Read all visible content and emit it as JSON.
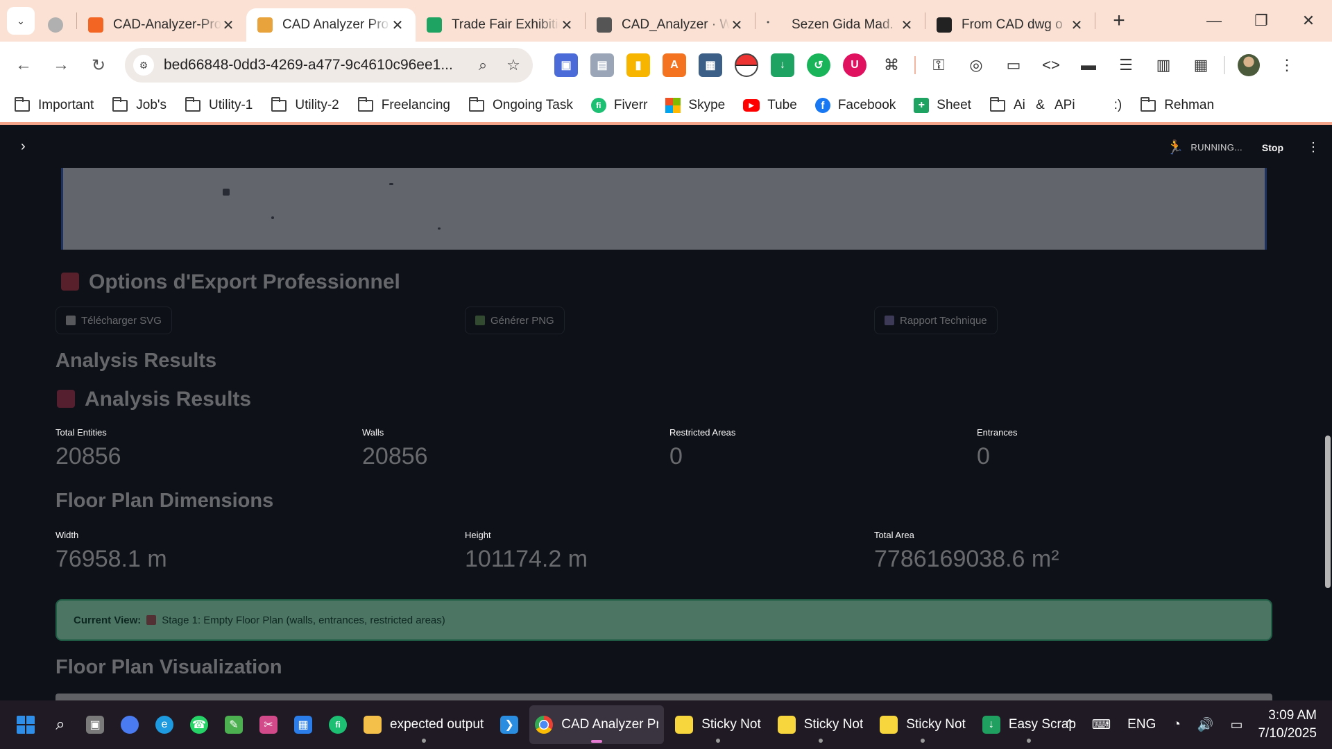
{
  "browser": {
    "tabs": [
      {
        "title": "",
        "favicon_color": "#b0b0b0"
      },
      {
        "title": "CAD-Analyzer-Pro",
        "favicon_color": "#f26522",
        "favicon": "replit-icon"
      },
      {
        "title": "CAD Analyzer Pro",
        "favicon_color": "#e8a33c",
        "favicon": "building-icon",
        "active": true
      },
      {
        "title": "Trade Fair Exhibition",
        "favicon_color": "#1ea362",
        "favicon": "sheets-icon"
      },
      {
        "title": "CAD_Analyzer · W",
        "favicon_color": "#555555",
        "favicon": "link-icon"
      },
      {
        "title": "Sezen Gida Mad.",
        "favicon_color": "#777777",
        "favicon": "dot-icon"
      },
      {
        "title": "From CAD dwg o",
        "favicon_color": "#222222",
        "favicon": "openai-icon"
      }
    ],
    "url": "bed66848-0dd3-4269-a477-9c4610c96ee1...",
    "bookmarks": [
      {
        "label": "Important",
        "icon": "folder-icon"
      },
      {
        "label": "Job's",
        "icon": "folder-icon"
      },
      {
        "label": "Utility-1",
        "icon": "folder-icon"
      },
      {
        "label": "Utility-2",
        "icon": "folder-icon"
      },
      {
        "label": "Freelancing",
        "icon": "folder-icon"
      },
      {
        "label": "Ongoing Task",
        "icon": "folder-icon"
      },
      {
        "label": "Fiverr",
        "icon": "fiverr-icon"
      },
      {
        "label": "Skype",
        "icon": "microsoft-icon"
      },
      {
        "label": "Tube",
        "icon": "youtube-icon"
      },
      {
        "label": "Facebook",
        "icon": "facebook-icon"
      },
      {
        "label": "Sheet",
        "icon": "sheets-icon"
      },
      {
        "label": "Ai & APi",
        "icon": "folder-icon"
      },
      {
        "label": ":)",
        "icon": ""
      },
      {
        "label": "Rehman",
        "icon": "folder-icon"
      }
    ]
  },
  "app": {
    "status": {
      "running": "RUNNING...",
      "stop": "Stop"
    },
    "export_heading": "Options d'Export Professionnel",
    "export_buttons": [
      {
        "label": "Télécharger SVG",
        "icon_color": "#cfcfcf"
      },
      {
        "label": "Générer PNG",
        "icon_color": "#6fae5a"
      },
      {
        "label": "Rapport Technique",
        "icon_color": "#8a7fc0"
      }
    ],
    "analysis_heading_plain": "Analysis Results",
    "analysis_heading_icon": "Analysis Results",
    "metrics_row1": [
      {
        "label": "Total Entities",
        "value": "20856"
      },
      {
        "label": "Walls",
        "value": "20856"
      },
      {
        "label": "Restricted Areas",
        "value": "0"
      },
      {
        "label": "Entrances",
        "value": "0"
      }
    ],
    "dimensions_heading": "Floor Plan Dimensions",
    "metrics_row2": [
      {
        "label": "Width",
        "value": "76958.1 m"
      },
      {
        "label": "Height",
        "value": "101174.2 m"
      },
      {
        "label": "Total Area",
        "value": "7786169038.6 m²"
      }
    ],
    "current_view": {
      "label": "Current View:",
      "text": "Stage 1: Empty Floor Plan (walls, entrances, restricted areas)"
    },
    "visualization_heading": "Floor Plan Visualization"
  },
  "taskbar": {
    "apps": [
      {
        "label": "",
        "icon": "windows-start-icon",
        "color": "#2f8fe8"
      },
      {
        "label": "",
        "icon": "search-icon",
        "color": "transparent"
      },
      {
        "label": "",
        "icon": "task-view-icon",
        "color": "#7a7a7a"
      },
      {
        "label": "",
        "icon": "copilot-icon",
        "color": "#4a7bf0"
      },
      {
        "label": "",
        "icon": "edge-icon",
        "color": "#1e9ae0"
      },
      {
        "label": "",
        "icon": "whatsapp-icon",
        "color": "#25d366"
      },
      {
        "label": "",
        "icon": "notepad-icon",
        "color": "#4caf50"
      },
      {
        "label": "",
        "icon": "snipping-icon",
        "color": "#d34a8a"
      },
      {
        "label": "",
        "icon": "store-icon",
        "color": "#2b7de9"
      },
      {
        "label": "",
        "icon": "fiverr-icon",
        "color": "#1dbf73"
      },
      {
        "label": "expected output",
        "icon": "folder-icon",
        "color": "#f5c04a"
      },
      {
        "label": "",
        "icon": "vscode-icon",
        "color": "#2b8de0"
      },
      {
        "label": "CAD Analyzer Pr",
        "icon": "chrome-icon",
        "color": "#e94235",
        "active": true
      },
      {
        "label": "Sticky Not",
        "icon": "sticky-notes-icon",
        "color": "#f7d53c"
      },
      {
        "label": "Sticky Not",
        "icon": "sticky-notes-icon",
        "color": "#f7d53c"
      },
      {
        "label": "Sticky Not",
        "icon": "sticky-notes-icon",
        "color": "#f7d53c"
      },
      {
        "label": "Easy Scrap",
        "icon": "easy-scraper-icon",
        "color": "#20a060"
      }
    ],
    "tray": {
      "language": "ENG",
      "time": "3:09 AM",
      "date": "7/10/2025"
    }
  }
}
